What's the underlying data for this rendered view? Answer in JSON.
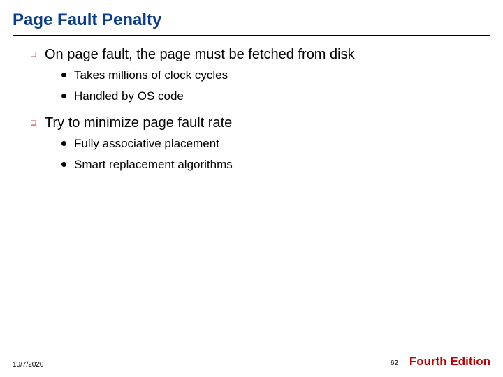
{
  "title": "Page Fault Penalty",
  "points": [
    {
      "text": "On page fault, the page must be fetched from disk",
      "sub": [
        "Takes millions of clock cycles",
        "Handled by OS code"
      ]
    },
    {
      "text": "Try to minimize page fault rate",
      "sub": [
        "Fully associative placement",
        "Smart replacement algorithms"
      ]
    }
  ],
  "footer": {
    "date": "10/7/2020",
    "page": "62",
    "edition": "Fourth Edition"
  }
}
